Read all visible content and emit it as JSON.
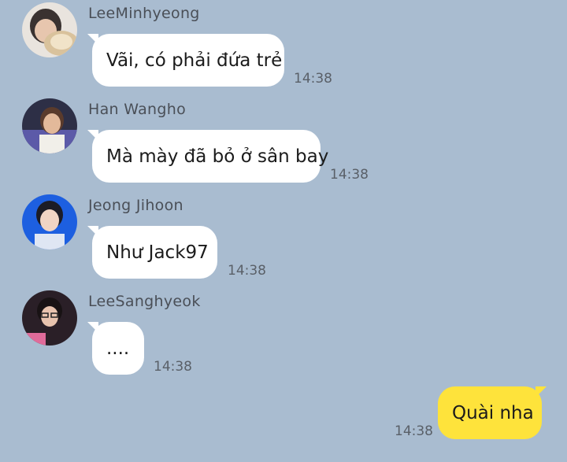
{
  "colors": {
    "background": "#a9bcd0",
    "incoming_bubble": "#ffffff",
    "outgoing_bubble": "#fee33b"
  },
  "messages": [
    {
      "sender": "LeeMinhyeong",
      "text": "Vãi, có phải đứa trẻ",
      "time": "14:38",
      "avatar": "avatar-dog-photo"
    },
    {
      "sender": "Han Wangho",
      "text": "Mà mày đã bỏ ở sân bay",
      "time": "14:38",
      "avatar": "avatar-player-photo"
    },
    {
      "sender": "Jeong Jihoon",
      "text": "Như Jack97",
      "time": "14:38",
      "avatar": "avatar-player-photo-blue"
    },
    {
      "sender": "LeeSanghyeok",
      "text": "....",
      "time": "14:38",
      "avatar": "avatar-player-photo-glasses"
    }
  ],
  "outgoing": {
    "text": "Quài nha",
    "time": "14:38"
  }
}
